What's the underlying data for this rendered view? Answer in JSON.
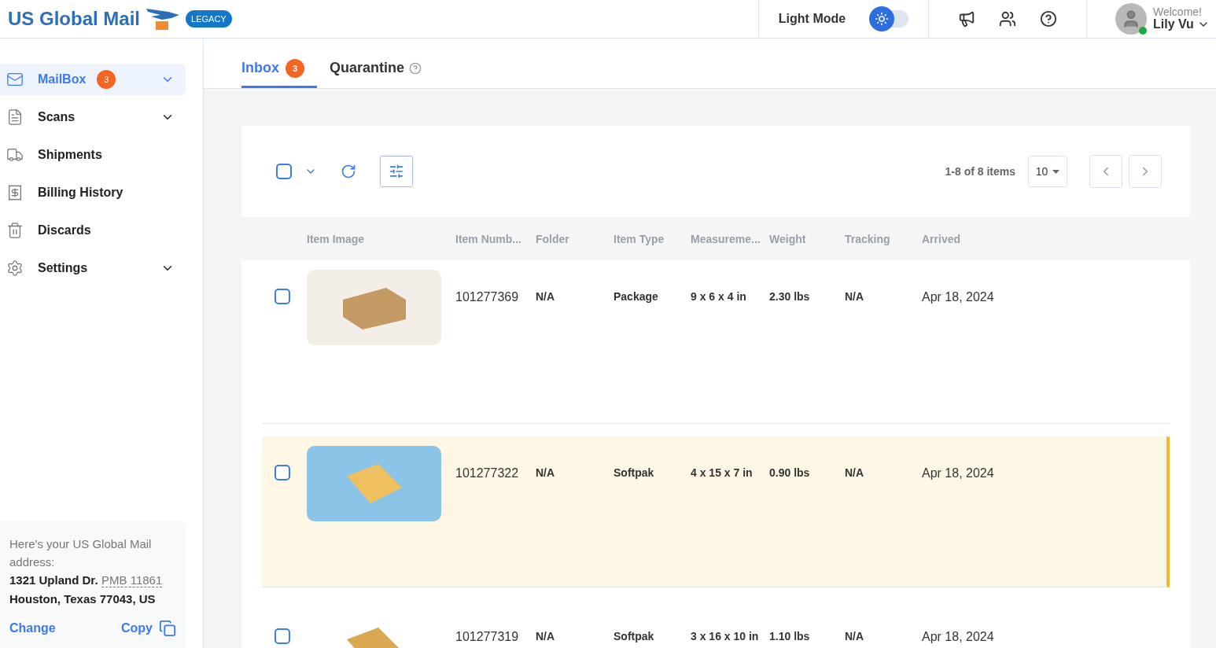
{
  "header": {
    "brand": "US Global Mail",
    "badge": "LEGACY",
    "theme_label": "Light Mode",
    "dark_mode": false,
    "welcome": "Welcome!",
    "user": "Lily Vu",
    "online": true
  },
  "sidebar": {
    "items": [
      {
        "label": "MailBox",
        "count": "3",
        "selected": true,
        "expandable": true
      },
      {
        "label": "Scans",
        "selected": false,
        "expandable": true
      },
      {
        "label": "Shipments",
        "selected": false,
        "expandable": false
      },
      {
        "label": "Billing History",
        "selected": false,
        "expandable": false
      },
      {
        "label": "Discards",
        "selected": false,
        "expandable": false
      },
      {
        "label": "Settings",
        "selected": false,
        "expandable": true
      }
    ],
    "address": {
      "intro": "Here's your US Global Mail address:",
      "line1": "1321 Upland Dr.",
      "pmb": "PMB 11861",
      "line2": "Houston, Texas 77043, US",
      "change": "Change",
      "copy": "Copy"
    }
  },
  "tabs": [
    {
      "label": "Inbox",
      "count": "3",
      "selected": true,
      "help": false
    },
    {
      "label": "Quarantine",
      "selected": false,
      "help": true
    }
  ],
  "toolbar": {
    "select_all": false,
    "range": "1-8 of 8 items",
    "page_size": "10"
  },
  "table": {
    "columns": [
      "Item Image",
      "Item Numb...",
      "Folder",
      "Item Type",
      "Measureme...",
      "Weight",
      "Tracking",
      "Arrived"
    ],
    "rows": [
      {
        "checked": false,
        "selected": false,
        "number": "101277369",
        "folder": "N/A",
        "type": "Package",
        "measure": "9 x 6 x 4 in",
        "weight": "2.30 lbs",
        "tracking": "N/A",
        "arrived": "Apr 18, 2024"
      },
      {
        "checked": false,
        "selected": true,
        "number": "101277322",
        "folder": "N/A",
        "type": "Softpak",
        "measure": "4 x 15 x 7 in",
        "weight": "0.90 lbs",
        "tracking": "N/A",
        "arrived": "Apr 18, 2024"
      },
      {
        "checked": false,
        "selected": false,
        "number": "101277319",
        "folder": "N/A",
        "type": "Softpak",
        "measure": "3 x 16 x 10 in",
        "weight": "1.10 lbs",
        "tracking": "N/A",
        "arrived": "Apr 18, 2024"
      }
    ]
  }
}
